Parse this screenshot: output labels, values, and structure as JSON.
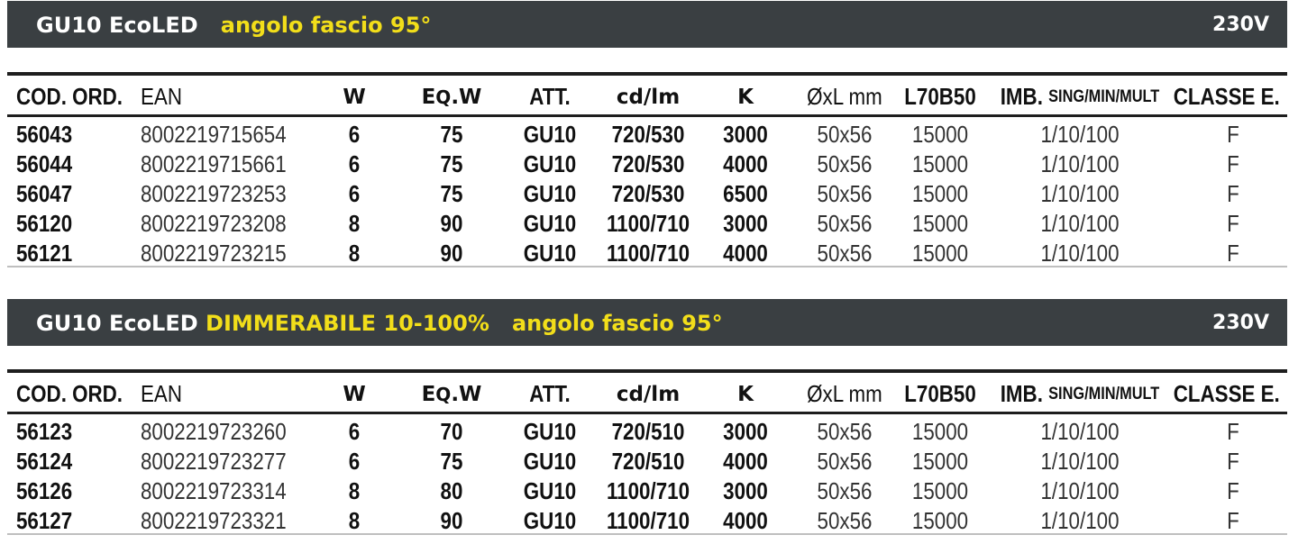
{
  "sections": [
    {
      "title_main": "GU10 EcoLED",
      "title_highlight": "",
      "title_beam": "angolo fascio 95°",
      "voltage": "230V",
      "rows": [
        {
          "cod": "56043",
          "ean": "8002219715654",
          "w": "6",
          "eqw": "75",
          "att": "GU10",
          "cdlm": "720/530",
          "k": "3000",
          "dxl": "50x56",
          "l70": "15000",
          "imb": "1/10/100",
          "cls": "F"
        },
        {
          "cod": "56044",
          "ean": "8002219715661",
          "w": "6",
          "eqw": "75",
          "att": "GU10",
          "cdlm": "720/530",
          "k": "4000",
          "dxl": "50x56",
          "l70": "15000",
          "imb": "1/10/100",
          "cls": "F"
        },
        {
          "cod": "56047",
          "ean": "8002219723253",
          "w": "6",
          "eqw": "75",
          "att": "GU10",
          "cdlm": "720/530",
          "k": "6500",
          "dxl": "50x56",
          "l70": "15000",
          "imb": "1/10/100",
          "cls": "F"
        },
        {
          "cod": "56120",
          "ean": "8002219723208",
          "w": "8",
          "eqw": "90",
          "att": "GU10",
          "cdlm": "1100/710",
          "k": "3000",
          "dxl": "50x56",
          "l70": "15000",
          "imb": "1/10/100",
          "cls": "F"
        },
        {
          "cod": "56121",
          "ean": "8002219723215",
          "w": "8",
          "eqw": "90",
          "att": "GU10",
          "cdlm": "1100/710",
          "k": "4000",
          "dxl": "50x56",
          "l70": "15000",
          "imb": "1/10/100",
          "cls": "F"
        }
      ]
    },
    {
      "title_main": "GU10 EcoLED",
      "title_highlight": "DIMMERABILE 10-100%",
      "title_beam": "angolo fascio 95°",
      "voltage": "230V",
      "rows": [
        {
          "cod": "56123",
          "ean": "8002219723260",
          "w": "6",
          "eqw": "70",
          "att": "GU10",
          "cdlm": "720/510",
          "k": "3000",
          "dxl": "50x56",
          "l70": "15000",
          "imb": "1/10/100",
          "cls": "F"
        },
        {
          "cod": "56124",
          "ean": "8002219723277",
          "w": "6",
          "eqw": "75",
          "att": "GU10",
          "cdlm": "720/510",
          "k": "4000",
          "dxl": "50x56",
          "l70": "15000",
          "imb": "1/10/100",
          "cls": "F"
        },
        {
          "cod": "56126",
          "ean": "8002219723314",
          "w": "8",
          "eqw": "80",
          "att": "GU10",
          "cdlm": "1100/710",
          "k": "3000",
          "dxl": "50x56",
          "l70": "15000",
          "imb": "1/10/100",
          "cls": "F"
        },
        {
          "cod": "56127",
          "ean": "8002219723321",
          "w": "8",
          "eqw": "90",
          "att": "GU10",
          "cdlm": "1100/710",
          "k": "4000",
          "dxl": "50x56",
          "l70": "15000",
          "imb": "1/10/100",
          "cls": "F"
        }
      ]
    }
  ],
  "headers": {
    "cod": "COD. ORD.",
    "ean": "EAN",
    "w": "W",
    "eqw_e": "E",
    "eqw_q": "Q",
    "eqw_w": ".W",
    "att": "ATT.",
    "cdlm": "cd/lm",
    "k": "K",
    "dxl": "ØxL mm",
    "l70": "L70B50",
    "imb_main": "IMB.",
    "imb_sub": "SING/MIN/MULT",
    "cls": "CLASSE E."
  },
  "colors": {
    "title_bar_bg": "#3a3f42",
    "title_text": "#ffffff",
    "highlight": "#f2de1a"
  }
}
